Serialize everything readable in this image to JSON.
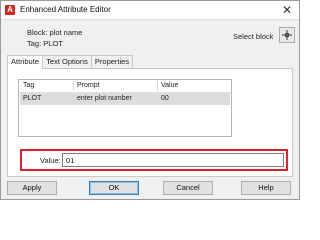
{
  "window": {
    "title": "Enhanced Attribute Editor",
    "close_glyph": "✕",
    "app_icon_letter": "A"
  },
  "block_info": {
    "block_line": "Block: plot name",
    "tag_line": "Tag: PLOT",
    "select_block_label": "Select block"
  },
  "tabs": [
    {
      "label": "Attribute",
      "active": true
    },
    {
      "label": "Text Options",
      "active": false
    },
    {
      "label": "Properties",
      "active": false
    }
  ],
  "attribute_list": {
    "columns": [
      "Tag",
      "Prompt",
      "Value"
    ],
    "rows": [
      {
        "tag": "PLOT",
        "prompt": "enter plot number",
        "value": "00",
        "selected": true
      }
    ]
  },
  "value_field": {
    "label": "Value:",
    "value": "01",
    "highlight_color": "#d9232d"
  },
  "buttons": {
    "apply": "Apply",
    "ok": "OK",
    "cancel": "Cancel",
    "help": "Help"
  },
  "icons": {
    "app": "autocad-app-icon",
    "close": "close-icon",
    "select_block": "pick-cursor-icon"
  }
}
